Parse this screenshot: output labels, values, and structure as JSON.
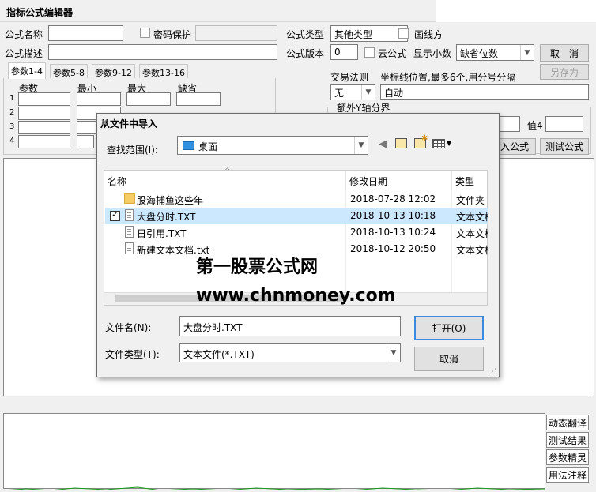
{
  "window": {
    "title": "指标公式编辑器"
  },
  "form": {
    "name_label": "公式名称",
    "name_value": "",
    "password_label": "密码保护",
    "desc_label": "公式描述",
    "desc_value": "",
    "type_label": "公式类型",
    "type_value": "其他类型",
    "draw_label": "画线方",
    "version_label": "公式版本",
    "version_value": "0",
    "cloud_label": "云公式",
    "decimal_label": "显示小数",
    "decimal_value": "缺省位数",
    "cancel_button": "取　消",
    "save_as_button": "另存为",
    "trade_rule_label": "交易法则",
    "trade_rule_value": "无",
    "axis_label": "坐标线位置,最多6个,用分号分隔",
    "axis_value": "自动",
    "extra_axis_label": "额外Y轴分界",
    "value4_label": "值4",
    "import_button": "入公式",
    "test_button": "测试公式"
  },
  "tabs": [
    "参数1-4",
    "参数5-8",
    "参数9-12",
    "参数13-16"
  ],
  "params": {
    "headers": [
      "参数",
      "最小",
      "最大",
      "缺省"
    ],
    "rows": [
      "1",
      "2",
      "3",
      "4"
    ]
  },
  "side_buttons": [
    "动态翻译",
    "测试结果",
    "参数精灵",
    "用法注释"
  ],
  "dialog": {
    "title": "从文件中导入",
    "lookin_label": "查找范围(I):",
    "lookin_value": "桌面",
    "columns": [
      "名称",
      "修改日期",
      "类型"
    ],
    "files": [
      {
        "name": "股海捕鱼这些年",
        "date": "2018-07-28 12:02",
        "type": "文件夹",
        "icon": "folder-icon"
      },
      {
        "name": "大盘分时.TXT",
        "date": "2018-10-13 10:18",
        "type": "文本文档",
        "icon": "file-icon"
      },
      {
        "name": "日引用.TXT",
        "date": "2018-10-13 10:24",
        "type": "文本文档",
        "icon": "file-icon"
      },
      {
        "name": "新建文本文档.txt",
        "date": "2018-10-12 20:50",
        "type": "文本文档",
        "icon": "file-icon"
      }
    ],
    "filename_label": "文件名(N):",
    "filename_value": "大盘分时.TXT",
    "filetype_label": "文件类型(T):",
    "filetype_value": "文本文件(*.TXT)",
    "open_button": "打开(O)",
    "cancel_button": "取消"
  },
  "watermark": {
    "line1": "第一股票公式网",
    "line2": "www.chnmoney.com"
  }
}
